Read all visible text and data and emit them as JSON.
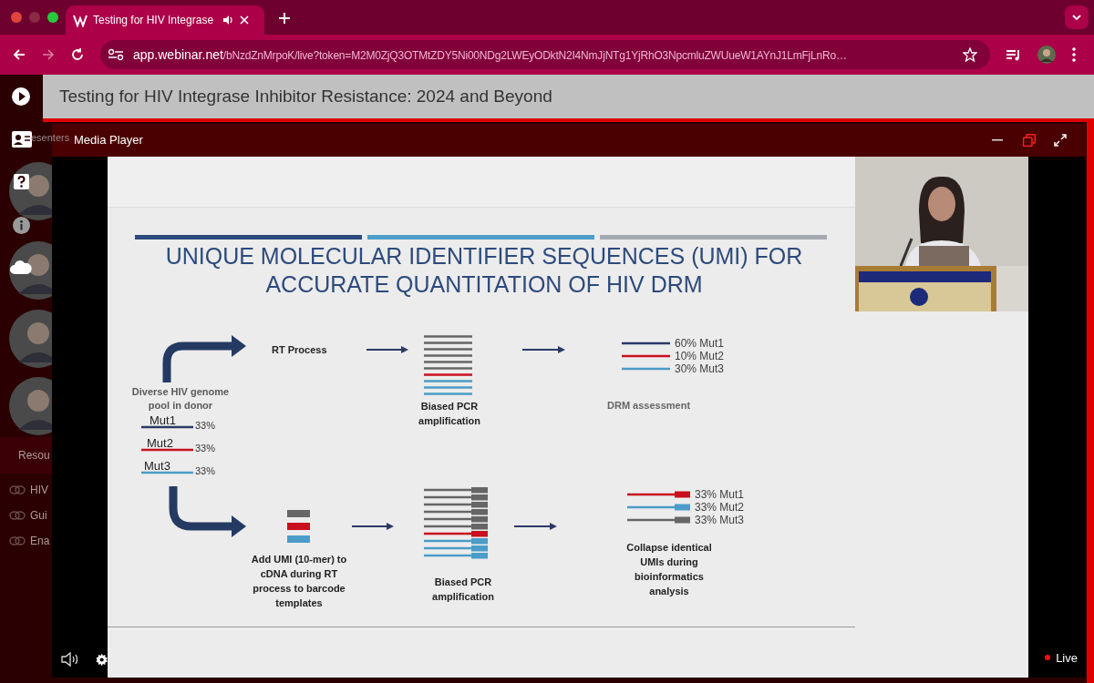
{
  "browser": {
    "tab": {
      "title": "Testing for HIV Integrase"
    },
    "address": {
      "host": "app.webinar.net",
      "path": "/bNzdZnMrpoK/live?token=M2M0ZjQ3OTMtZDY5Ni00NDg2LWEyODktN2I4NmJjNTg1YjRhO3NpcmluZWUueW1AYnJ1LmFjLnRo…"
    }
  },
  "page_title": "Testing for HIV Integrase Inhibitor Resistance: 2024 and Beyond",
  "behind": {
    "presenters_label": "esenters",
    "resources_label": "Resou",
    "links": [
      "HIV",
      "Gui",
      "Ena"
    ]
  },
  "media_player": {
    "title": "Media Player",
    "live_label": "Live",
    "slide": {
      "title_lines": [
        "UNIQUE MOLECULAR IDENTIFIER SEQUENCES (UMI) FOR",
        "ACCURATE QUANTITATION OF HIV DRM"
      ],
      "header_bars": [
        {
          "color": "#2d4a7c"
        },
        {
          "color": "#4d9ec9"
        },
        {
          "color": "#a3a9ae"
        }
      ],
      "pool": {
        "label": "Diverse HIV genome pool in donor",
        "variants": [
          {
            "name": "Mut1",
            "share": "33%",
            "color": "#2b3a67"
          },
          {
            "name": "Mut2",
            "share": "33%",
            "color": "#c8101e"
          },
          {
            "name": "Mut3",
            "share": "33%",
            "color": "#4b9cc8"
          }
        ]
      },
      "rt_process": "RT Process",
      "pcr_top": {
        "label": "Biased PCR amplification",
        "tagged": false,
        "strands": [
          {
            "color": "#666666"
          },
          {
            "color": "#666666"
          },
          {
            "color": "#666666"
          },
          {
            "color": "#666666"
          },
          {
            "color": "#666666"
          },
          {
            "color": "#666666"
          },
          {
            "color": "#c8101e"
          },
          {
            "color": "#4b9cc8"
          },
          {
            "color": "#4b9cc8"
          },
          {
            "color": "#4b9cc8"
          }
        ]
      },
      "drm": {
        "label": "DRM assessment",
        "rows": [
          {
            "text": "60% Mut1",
            "color": "#2b3a67"
          },
          {
            "text": "10% Mut2",
            "color": "#c8101e"
          },
          {
            "text": "30% Mut3",
            "color": "#4b9cc8"
          }
        ]
      },
      "umi": {
        "label": "Add UMI (10-mer) to cDNA during RT process to barcode templates",
        "blocks": [
          {
            "color": "#666666"
          },
          {
            "color": "#c8101e"
          },
          {
            "color": "#4b9cc8"
          }
        ]
      },
      "pcr_bottom": {
        "label": "Biased PCR amplification",
        "tagged": true,
        "strands": [
          {
            "color": "#666666"
          },
          {
            "color": "#666666"
          },
          {
            "color": "#666666"
          },
          {
            "color": "#666666"
          },
          {
            "color": "#666666"
          },
          {
            "color": "#666666"
          },
          {
            "color": "#c8101e"
          },
          {
            "color": "#4b9cc8"
          },
          {
            "color": "#4b9cc8"
          },
          {
            "color": "#4b9cc8"
          }
        ]
      },
      "collapse": {
        "label": "Collapse identical UMIs during bioinformatics analysis",
        "rows": [
          {
            "text": "33% Mut1",
            "color": "#c8101e"
          },
          {
            "text": "33% Mut2",
            "color": "#4b9cc8"
          },
          {
            "text": "33% Mut3",
            "color": "#666666"
          }
        ]
      }
    }
  }
}
